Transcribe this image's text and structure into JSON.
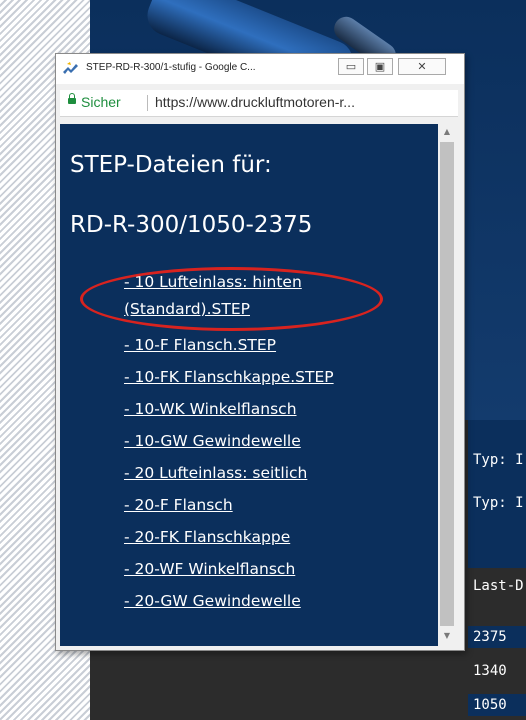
{
  "browser": {
    "title": "STEP-RD-R-300/1-stufig - Google C...",
    "secure_label": "Sicher",
    "url": "https://www.druckluftmotoren-r..."
  },
  "popup": {
    "heading1": "STEP-Dateien für:",
    "heading2": "RD-R-300/1050-2375",
    "links": [
      "- 10 Lufteinlass: hinten",
      "(Standard).STEP",
      "- 10-F Flansch.STEP",
      "- 10-FK Flanschkappe.STEP",
      "- 10-WK Winkelflansch",
      "- 10-GW Gewindewelle",
      "- 20 Lufteinlass: seitlich",
      "- 20-F Flansch",
      "- 20-FK Flanschkappe",
      "- 20-WF Winkelflansch",
      "- 20-GW Gewindewelle"
    ]
  },
  "background_page": {
    "typ_rows": [
      "Typ: I",
      "Typ: I"
    ],
    "last_label": "Last-D",
    "values": [
      "2375",
      "1340",
      "1050"
    ]
  },
  "colors": {
    "page_blue": "#0b2f5c",
    "highlight_red": "#d8231f",
    "secure_green": "#1e8e3e"
  }
}
